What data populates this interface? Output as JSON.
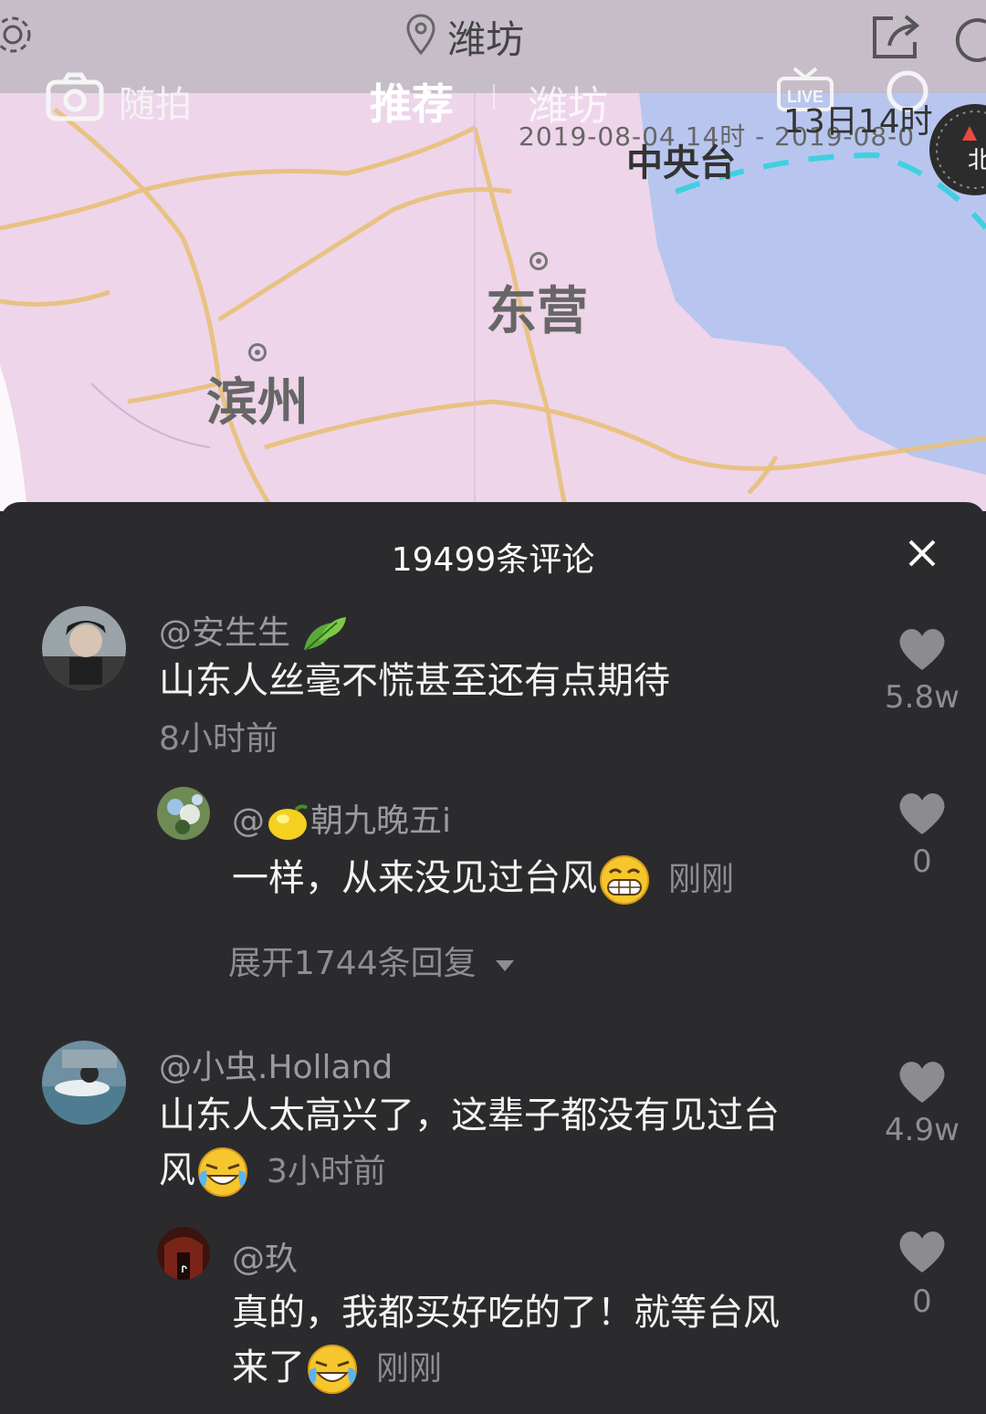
{
  "topbar": {
    "location": "潍坊",
    "camera_label": "随拍",
    "tab_recommend": "推荐",
    "tab_city": "潍坊",
    "live_label": "LIVE",
    "date_range": "2019-08-04 14时 - 2019-08-0",
    "date_day": "13日14时",
    "source": "中央台",
    "compass_label": "北"
  },
  "map": {
    "cities": [
      "东营",
      "滨州"
    ]
  },
  "panel": {
    "title": "19499条评论"
  },
  "comments": [
    {
      "username": "@安生生",
      "text": "山东人丝毫不慌甚至还有点期待",
      "time": "8小时前",
      "likes": "5.8w"
    },
    {
      "username": "@",
      "username_suffix": "朝九晚五i",
      "text": "一样，从来没见过台风",
      "time": "刚刚",
      "likes": "0"
    },
    {
      "expand": "展开1744条回复"
    },
    {
      "username": "@小虫.Holland",
      "text_line1": "山东人太高兴了，这辈子都没有见过台",
      "text_line2": "风",
      "time": "3小时前",
      "likes": "4.9w"
    },
    {
      "username": "@玖",
      "text_line1": "真的，我都买好吃的了！就等台风",
      "text_line2": "来了",
      "time": "刚刚",
      "likes": "0"
    }
  ],
  "colors": {
    "map_land": "#eed5ea",
    "map_sea": "#b7c6f0",
    "panel_bg": "#2b2b2d",
    "road": "#e8c07a"
  }
}
